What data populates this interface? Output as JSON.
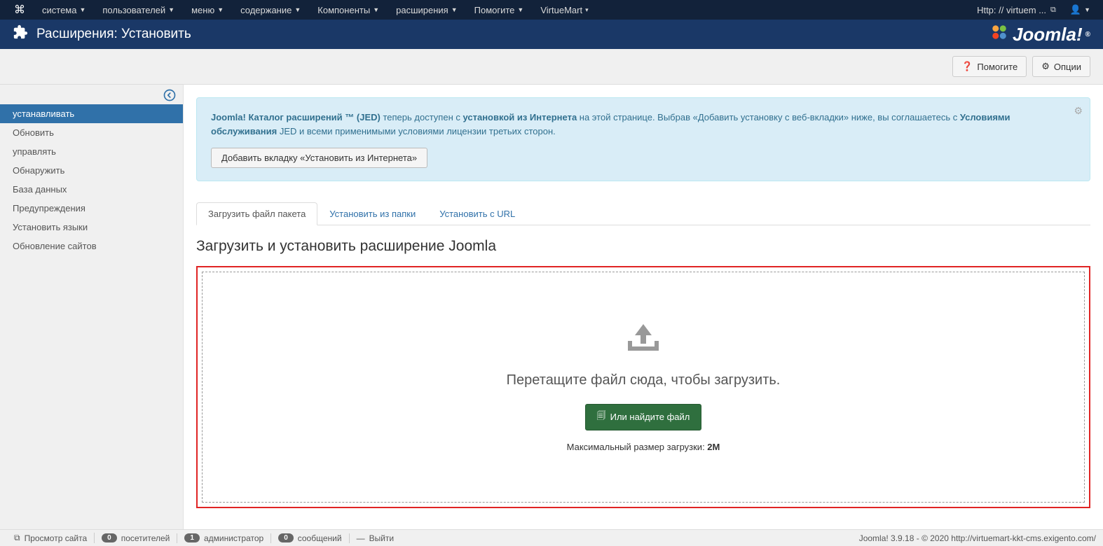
{
  "topMenu": {
    "items": [
      "система",
      "пользователей",
      "меню",
      "содержание",
      "Компоненты",
      "расширения",
      "Помогите",
      "VirtueMart"
    ],
    "dropdownFlags": [
      true,
      true,
      true,
      true,
      true,
      true,
      true,
      true
    ],
    "siteLink": "Http: // virtuem ..."
  },
  "titleBar": {
    "title": "Расширения: Установить",
    "brand": "Joomla!"
  },
  "toolbar": {
    "help": "Помогите",
    "options": "Опции"
  },
  "sidebar": {
    "items": [
      "устанавливать",
      "Обновить",
      "управлять",
      "Обнаружить",
      "База данных",
      "Предупреждения",
      "Установить языки",
      "Обновление сайтов"
    ],
    "activeIndex": 0
  },
  "infoBox": {
    "boldLead": "Joomla! Каталог расширений ™ (JED)",
    "text1": " теперь доступен с ",
    "boldMid": "установкой из Интернета",
    "text2": " на этой странице. Выбрав «Добавить установку с веб-вкладки» ниже, вы соглашаетесь с ",
    "boldTerms": "Условиями",
    "boldTerms2": "обслуживания",
    "text3": " JED и всеми применимыми условиями лицензии третьих сторон.",
    "button": "Добавить вкладку «Установить из Интернета»"
  },
  "tabs": {
    "items": [
      "Загрузить файл пакета",
      "Установить из папки",
      "Установить с URL"
    ],
    "activeIndex": 0
  },
  "uploadSection": {
    "heading": "Загрузить и установить расширение Joomla",
    "dropText": "Перетащите файл сюда, чтобы загрузить.",
    "browseBtn": "Или найдите файл",
    "maxSizeLabel": "Максимальный размер загрузки: ",
    "maxSizeValue": "2M"
  },
  "statusBar": {
    "viewSite": "Просмотр сайта",
    "visitors": {
      "count": "0",
      "label": "посетителей"
    },
    "admins": {
      "count": "1",
      "label": "администратор"
    },
    "messages": {
      "count": "0",
      "label": "сообщений"
    },
    "logout": "Выйти",
    "footer": "Joomla! 3.9.18 - © 2020 http://virtuemart-kkt-cms.exigento.com/"
  }
}
